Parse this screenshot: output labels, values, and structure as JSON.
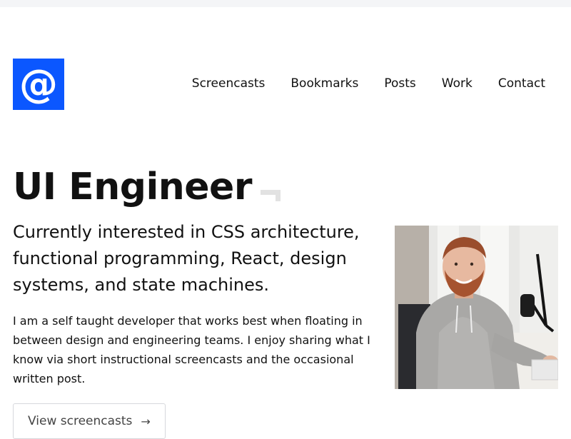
{
  "header": {
    "logo_glyph": "@",
    "nav": [
      {
        "label": "Screencasts",
        "icon": null
      },
      {
        "label": "Bookmarks"
      },
      {
        "label": "Posts"
      },
      {
        "label": "Work"
      },
      {
        "label": "Contact"
      }
    ]
  },
  "hero": {
    "title": "UI Engineer",
    "lead": "Currently interested in CSS architecture, functional programming, React, design systems, and state machines.",
    "body": "I am a self taught developer that works best when floating in between design and engineering teams. I enjoy sharing what I know via short instructional screencasts and the occasional written post.",
    "cta_label": "View screencasts",
    "cta_icon": "arrow-right-icon"
  },
  "colors": {
    "brand_blue": "#0b57ff",
    "text": "#111111",
    "muted_text": "#444444",
    "border": "#d6d8dc"
  }
}
